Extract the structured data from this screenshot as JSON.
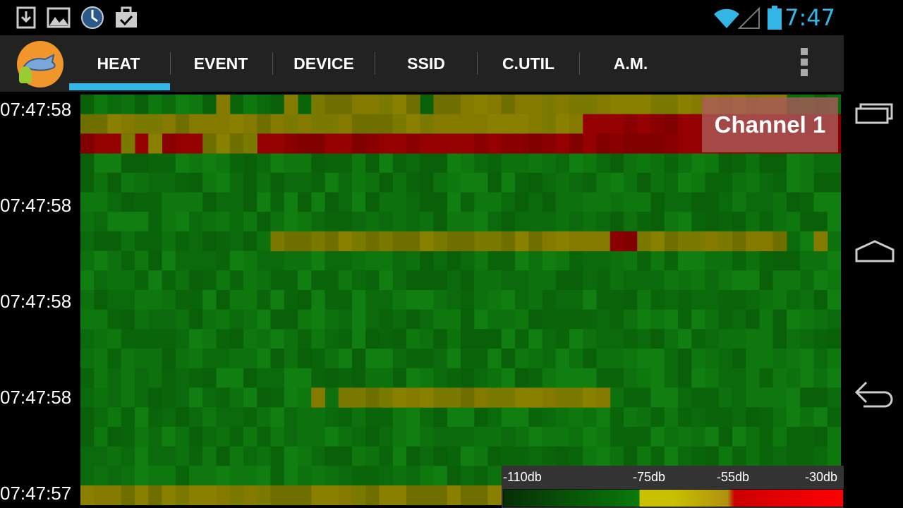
{
  "status": {
    "time": "7:47",
    "left_icons": [
      "download-icon",
      "image-icon",
      "clock-app-icon",
      "briefcase-check-icon"
    ],
    "right_icons": [
      "wifi-icon",
      "signal-icon",
      "battery-icon"
    ],
    "accent": "#33b5e5"
  },
  "tabs": [
    {
      "label": "HEAT",
      "selected": true
    },
    {
      "label": "EVENT",
      "selected": false
    },
    {
      "label": "DEVICE",
      "selected": false
    },
    {
      "label": "SSID",
      "selected": false
    },
    {
      "label": "C.UTIL",
      "selected": false
    },
    {
      "label": "A.M.",
      "selected": false
    }
  ],
  "timestamps": [
    "07:47:58",
    "07:47:58",
    "07:47:58",
    "07:47:58",
    "07:47:57"
  ],
  "channel": "Channel 1",
  "legend": {
    "labels": [
      "-110db",
      "-75db",
      "-55db",
      "-30db"
    ]
  },
  "colors": {
    "green": "#0b6a0b",
    "yellow": "#7a7a00",
    "red": "#8a0000"
  }
}
